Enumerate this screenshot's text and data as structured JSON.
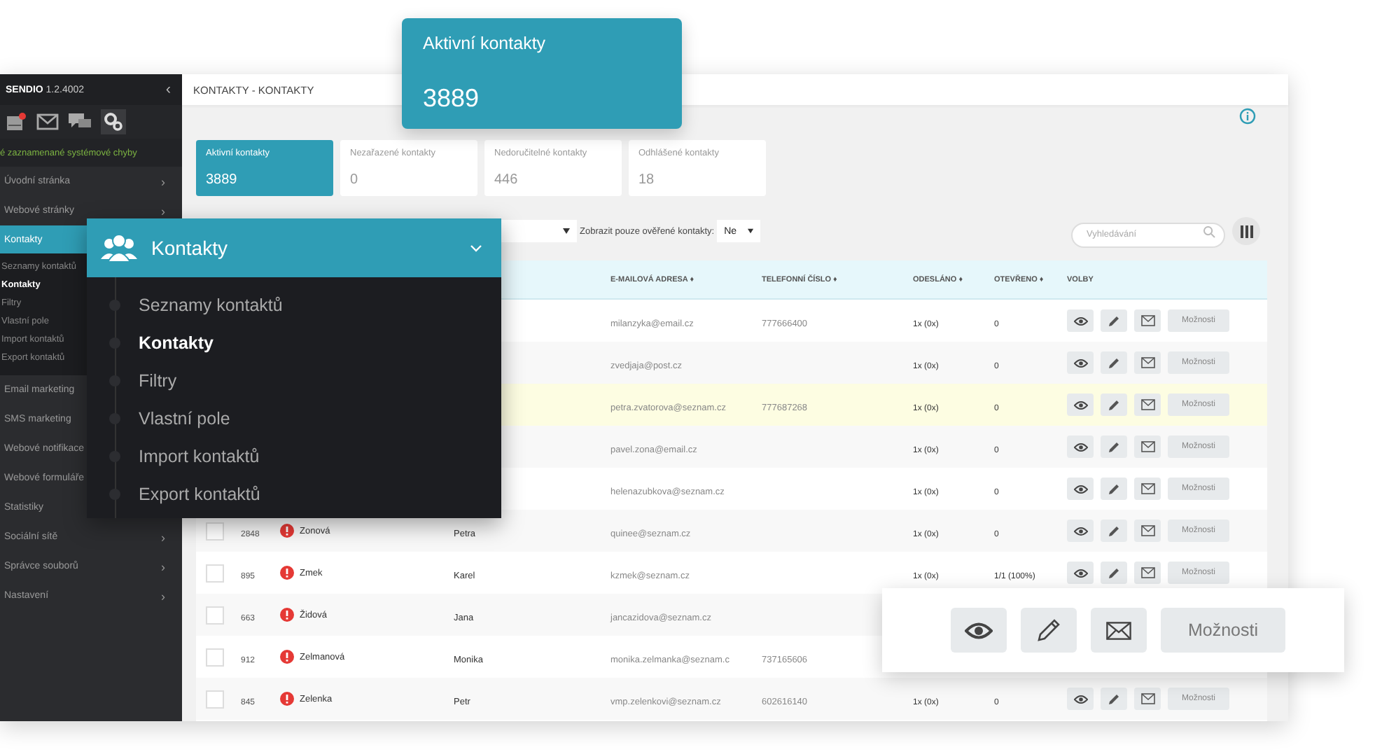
{
  "app": {
    "name": "SENDIO",
    "version": "1.2.4002",
    "collapse": "‹"
  },
  "alert": "é zaznamenané systémové chyby",
  "sidebar": {
    "items": [
      {
        "label": "Úvodní stránka",
        "arrow": "›",
        "selected": false
      },
      {
        "label": "Webové stránky",
        "arrow": "›",
        "selected": false
      },
      {
        "label": "Kontakty",
        "selected": true,
        "children": [
          {
            "label": "Seznamy kontaktů",
            "selected": false
          },
          {
            "label": "Kontakty",
            "selected": true
          },
          {
            "label": "Filtry",
            "selected": false
          },
          {
            "label": "Vlastní pole",
            "selected": false
          },
          {
            "label": "Import kontaktů",
            "selected": false
          },
          {
            "label": "Export kontaktů",
            "selected": false
          }
        ]
      },
      {
        "label": "Email marketing",
        "selected": false
      },
      {
        "label": "SMS marketing",
        "selected": false
      },
      {
        "label": "Webové notifikace",
        "selected": false
      },
      {
        "label": "Webové formuláře",
        "selected": false
      },
      {
        "label": "Statistiky",
        "selected": false
      },
      {
        "label": "Sociální sítě",
        "arrow": "›",
        "selected": false
      },
      {
        "label": "Správce souborů",
        "arrow": "›",
        "selected": false
      },
      {
        "label": "Nastavení",
        "arrow": "›",
        "selected": false
      }
    ]
  },
  "breadcrumb": "KONTAKTY - KONTAKTY",
  "stats": [
    {
      "label": "Aktivní kontakty",
      "value": "3889",
      "selected": true
    },
    {
      "label": "Nezařazené kontakty",
      "value": "0",
      "selected": false
    },
    {
      "label": "Nedoručitelné kontakty",
      "value": "446",
      "selected": false
    },
    {
      "label": "Odhlášené kontakty",
      "value": "18",
      "selected": false
    }
  ],
  "filters": {
    "verified_label": "Zobrazit pouze ověřené kontakty:",
    "verified_value": "Ne",
    "search": {
      "placeholder": "Vyhledávání"
    }
  },
  "table": {
    "columns": [
      {
        "label": "E-MAILOVÁ ADRESA ♦"
      },
      {
        "label": "TELEFONNÍ ČÍSLO ♦"
      },
      {
        "label": "ODESLÁNO ♦"
      },
      {
        "label": "OTEVŘENO ♦"
      },
      {
        "label": "VOLBY"
      }
    ],
    "rows": [
      {
        "email": "milanzyka@email.cz",
        "phone": "777666400",
        "sent": "1x (0x)",
        "opened": "0",
        "options": "Možnosti",
        "highlighted": false
      },
      {
        "email": "zvedjaja@post.cz",
        "sent": "1x (0x)",
        "opened": "0",
        "options": "Možnosti",
        "highlighted": false
      },
      {
        "email": "petra.zvatorova@seznam.cz",
        "phone": "777687268",
        "sent": "1x (0x)",
        "opened": "0",
        "options": "Možnosti",
        "highlighted": true
      },
      {
        "email": "pavel.zona@email.cz",
        "sent": "1x (0x)",
        "opened": "0",
        "options": "Možnosti",
        "highlighted": false
      },
      {
        "email": "helenazubkova@seznam.cz",
        "sent": "1x (0x)",
        "opened": "0",
        "options": "Možnosti",
        "highlighted": false
      },
      {
        "id": "2848",
        "warning": true,
        "surname": "Zonová",
        "first_name": "Petra",
        "email": "quinee@seznam.cz",
        "sent": "1x (0x)",
        "opened": "0",
        "options": "Možnosti",
        "highlighted": false
      },
      {
        "id": "895",
        "warning": true,
        "surname": "Zmek",
        "first_name": "Karel",
        "email": "kzmek@seznam.cz",
        "sent": "1x (0x)",
        "opened": "1/1 (100%)",
        "options": "Možnosti",
        "highlighted": false
      },
      {
        "id": "663",
        "warning": true,
        "surname": "Židová",
        "first_name": "Jana",
        "email": "jancazidova@seznam.cz",
        "highlighted": false
      },
      {
        "id": "912",
        "warning": true,
        "surname": "Zelmanová",
        "first_name": "Monika",
        "email": "monika.zelmanka@seznam.c",
        "phone": "737165606",
        "highlighted": false
      },
      {
        "id": "845",
        "warning": true,
        "surname": "Zelenka",
        "first_name": "Petr",
        "email": "vmp.zelenkovi@seznam.cz",
        "phone": "602616140",
        "sent": "1x (0x)",
        "opened": "0",
        "options": "Možnosti",
        "highlighted": false
      }
    ]
  },
  "callouts": {
    "stat_card": {
      "label": "Aktivní kontakty",
      "value": "3889"
    },
    "menu": {
      "title": "Kontakty",
      "items": [
        {
          "label": "Seznamy kontaktů",
          "selected": false
        },
        {
          "label": "Kontakty",
          "selected": true
        },
        {
          "label": "Filtry",
          "selected": false
        },
        {
          "label": "Vlastní pole",
          "selected": false
        },
        {
          "label": "Import kontaktů",
          "selected": false
        },
        {
          "label": "Export kontaktů",
          "selected": false
        }
      ]
    },
    "actions": {
      "options": "Možnosti"
    }
  }
}
